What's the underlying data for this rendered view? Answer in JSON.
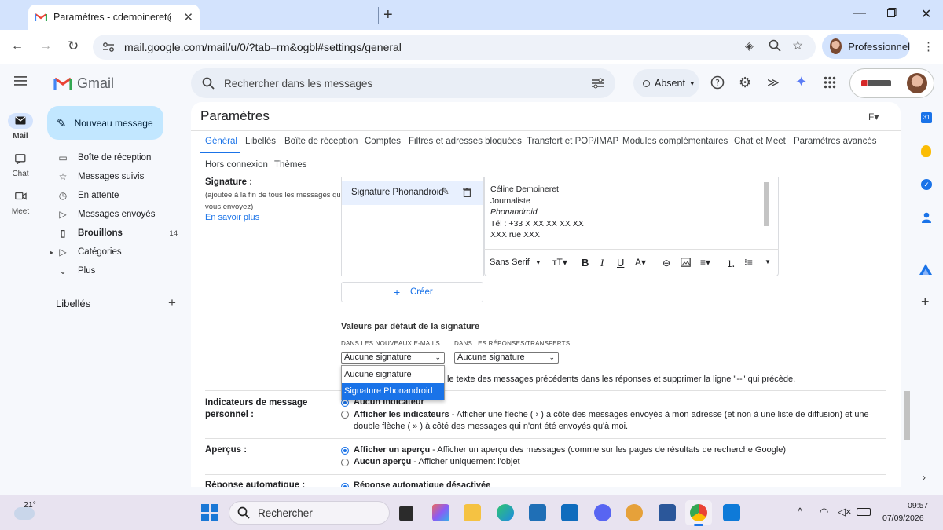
{
  "browser": {
    "tab_title": "Paramètres - cdemoineret@ph",
    "url": "mail.google.com/mail/u/0/?tab=rm&ogbl#settings/general",
    "profile_label": "Professionnel"
  },
  "gmail": {
    "logo_text": "Gmail",
    "search_placeholder": "Rechercher dans les messages",
    "status_label": "Absent",
    "rail": [
      {
        "label": "Mail"
      },
      {
        "label": "Chat"
      },
      {
        "label": "Meet"
      }
    ],
    "compose_label": "Nouveau message",
    "nav": [
      {
        "label": "Boîte de réception",
        "icon": "inbox-icon",
        "count": ""
      },
      {
        "label": "Messages suivis",
        "icon": "star-icon",
        "count": ""
      },
      {
        "label": "En attente",
        "icon": "clock-icon",
        "count": ""
      },
      {
        "label": "Messages envoyés",
        "icon": "send-icon",
        "count": ""
      },
      {
        "label": "Brouillons",
        "icon": "draft-icon",
        "count": "14"
      },
      {
        "label": "Catégories",
        "icon": "label-icon",
        "count": ""
      },
      {
        "label": "Plus",
        "icon": "chevron-down-icon",
        "count": ""
      }
    ],
    "labels_heading": "Libellés"
  },
  "settings": {
    "title": "Paramètres",
    "tabs_row1": [
      "Général",
      "Libellés",
      "Boîte de réception",
      "Comptes",
      "Filtres et adresses bloquées",
      "Transfert et POP/IMAP",
      "Modules complémentaires",
      "Chat et Meet",
      "Paramètres avancés"
    ],
    "tabs_row2": [
      "Hors connexion",
      "Thèmes"
    ],
    "signature": {
      "label": "Signature :",
      "hint": "(ajoutée à la fin de tous les messages que vous envoyez)",
      "learn_more": "En savoir plus",
      "item_name": "Signature Phonandroid",
      "body_lines": [
        "Céline Demoineret",
        "Journaliste",
        "Phonandroid",
        "Tél : +33 X XX XX XX XX",
        "XXX rue XXX"
      ],
      "font_name": "Sans Serif",
      "create_label": "Créer",
      "defaults_heading": "Valeurs par défaut de la signature",
      "new_emails_label": "DANS LES NOUVEAUX E-MAILS",
      "replies_label": "DANS LES RÉPONSES/TRANSFERTS",
      "new_emails_value": "Aucune signature",
      "replies_value": "Aucune signature",
      "dropdown_options": [
        "Aucune signature",
        "Signature Phonandroid"
      ],
      "insert_text": "le texte des messages précédents dans les réponses et supprimer la ligne \"--\" qui précède."
    },
    "indicators": {
      "label": "Indicateurs de message personnel :",
      "option1": "Aucun indicateur",
      "option2_bold": "Afficher les indicateurs",
      "option2_text": " - Afficher une flèche ( › ) à côté des messages envoyés à mon adresse (et non à une liste de diffusion) et une double flèche ( » ) à côté des messages qui n'ont été envoyés qu'à moi."
    },
    "preview": {
      "label": "Aperçus :",
      "option1_bold": "Afficher un aperçu",
      "option1_text": " - Afficher un aperçu des messages (comme sur les pages de résultats de recherche Google)",
      "option2_bold": "Aucun aperçu",
      "option2_text": " - Afficher uniquement l'objet"
    },
    "auto_reply_label": "Réponse automatique :",
    "auto_reply_value": "Réponse automatique désactivée"
  },
  "taskbar": {
    "weather": "21°",
    "search_placeholder": "Rechercher",
    "time": "09:57",
    "date": "07/09/2026"
  },
  "colors": {
    "accent": "#1a73e8",
    "compose_bg": "#c2e7ff",
    "tab_bar": "#d3e3fd",
    "dropdown_selected": "#1a73e8"
  }
}
